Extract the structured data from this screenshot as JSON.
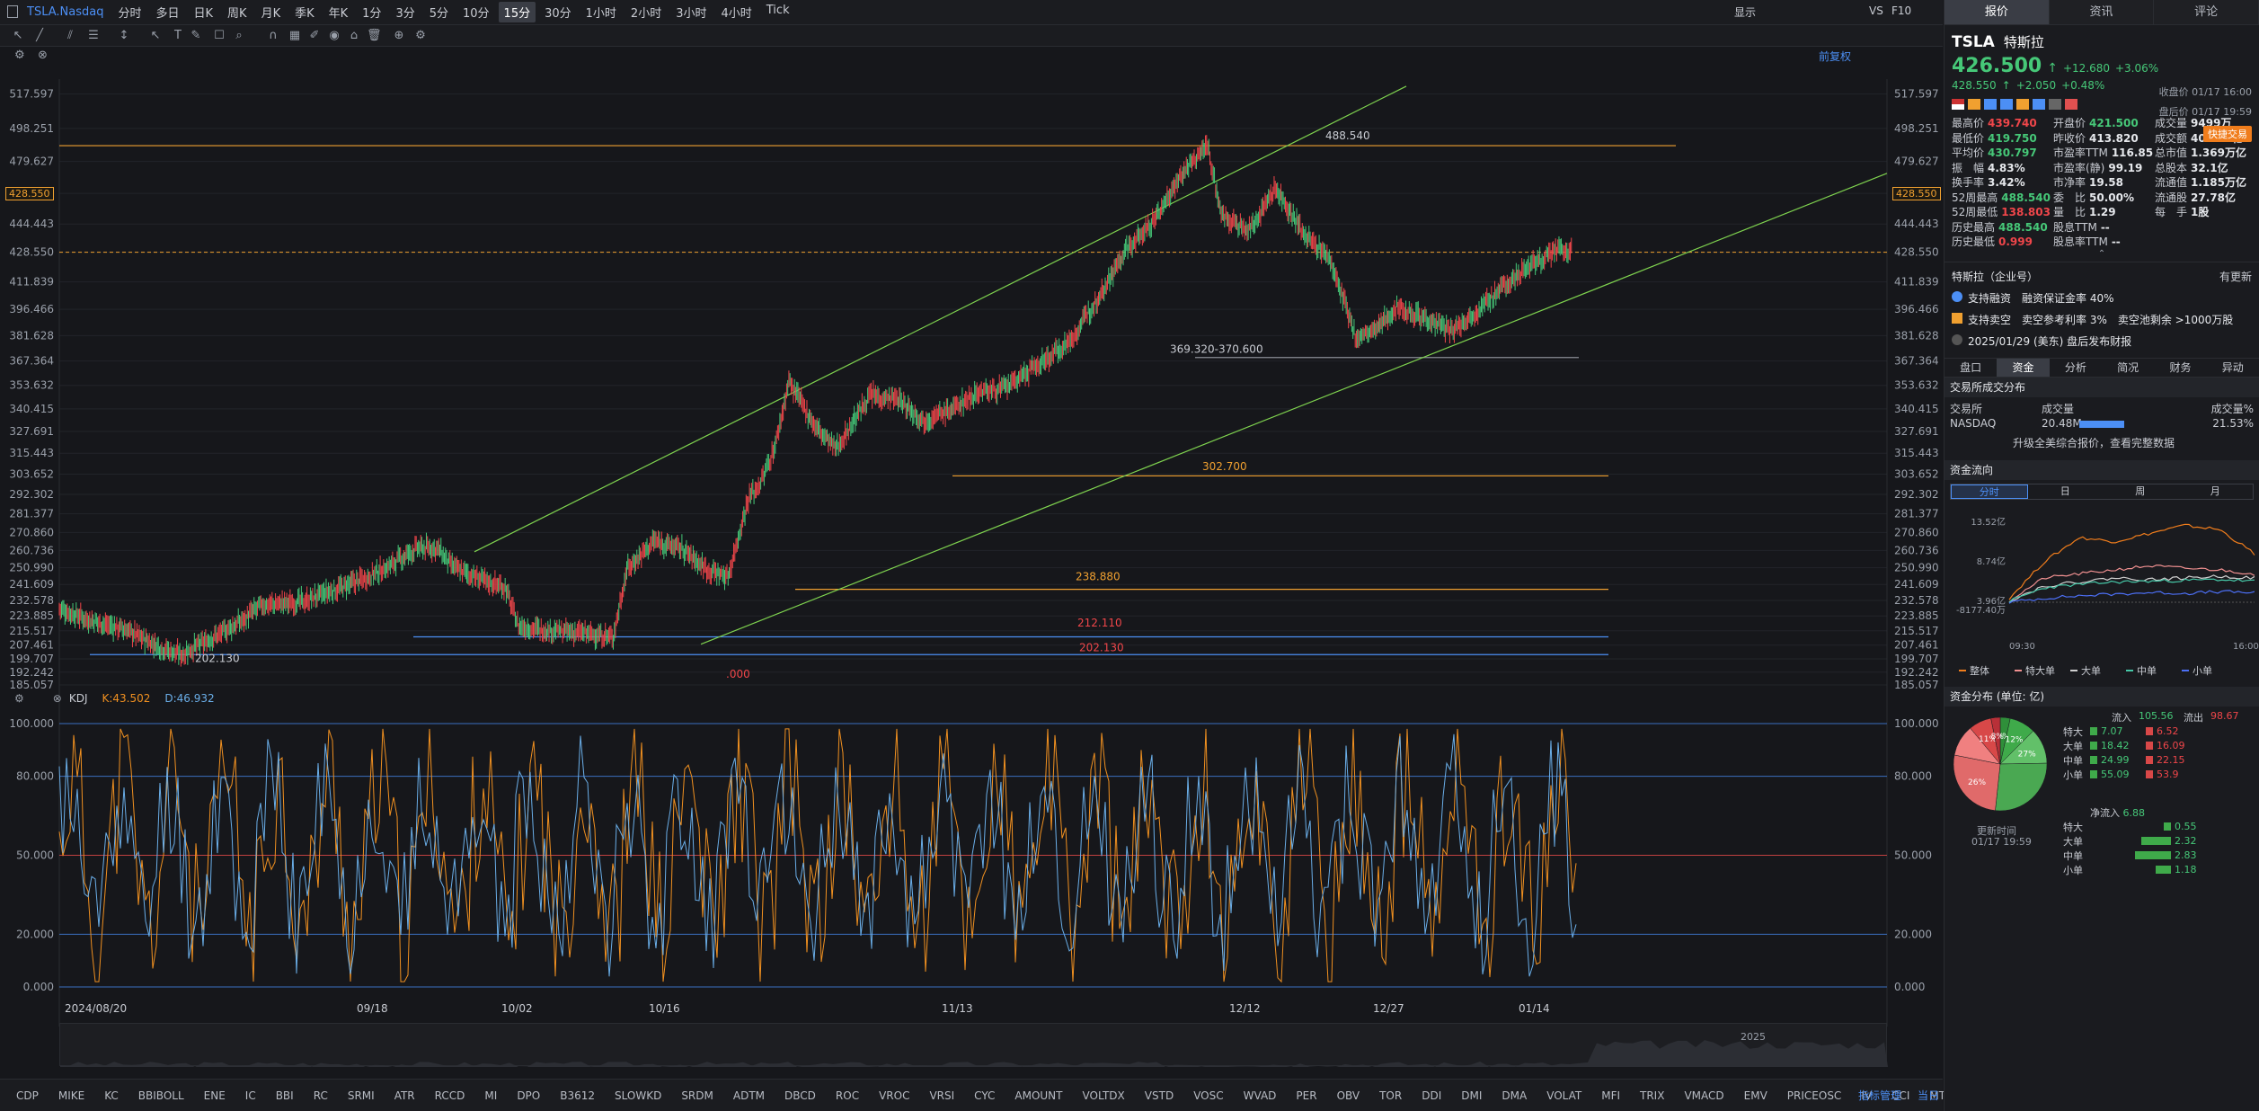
{
  "topbar": {
    "symbol": "TSLA.Nasdaq",
    "periods": [
      "分时",
      "多日",
      "日K",
      "周K",
      "月K",
      "季K",
      "年K",
      "1分",
      "3分",
      "5分",
      "10分",
      "15分",
      "30分",
      "1小时",
      "2小时",
      "3小时",
      "4小时",
      "Tick"
    ],
    "active_period": "15分",
    "right": {
      "display": "显示",
      "vs": "VS",
      "f10": "F10"
    }
  },
  "chart_header": {
    "adjust": "前复权"
  },
  "colors": {
    "up": "#f0464a",
    "down": "#46c878",
    "candle_up": "#f0464a",
    "orange_line": "#f0a030",
    "blue_line": "#4c8ff5",
    "green_channel": "#7fd34f",
    "k_line": "#f09020",
    "d_line": "#6aaee8",
    "bg": "#16171b"
  },
  "chart_data": [
    {
      "type": "line",
      "ylim": [
        185.057,
        526
      ],
      "y_ticks": [
        "517.597",
        "498.251",
        "479.627",
        "461.700",
        "444.443",
        "428.550",
        "411.839",
        "396.466",
        "381.628",
        "367.364",
        "353.632",
        "340.415",
        "327.691",
        "315.443",
        "303.652",
        "292.302",
        "281.377",
        "270.860",
        "260.736",
        "250.990",
        "241.609",
        "232.578",
        "223.885",
        "215.517",
        "207.461",
        "199.707",
        "192.242",
        "185.057"
      ],
      "x_ticks": [
        "2024/08/20",
        "09/18",
        "10/02",
        "10/16",
        "11/13",
        "12/12",
        "12/27",
        "01/14"
      ],
      "current_price_label": "428.550",
      "annotations": [
        "488.540",
        "369.320-370.600",
        "302.700",
        "238.880",
        "212.110",
        "202.130",
        "202.130",
        ".000"
      ],
      "horizontal_levels": [
        {
          "label": "488.540",
          "value": 488.54,
          "color": "orange"
        },
        {
          "label": "369.320-370.600",
          "value": 369.32,
          "color": "grey"
        },
        {
          "label": "302.700",
          "value": 302.7,
          "color": "orange"
        },
        {
          "label": "238.880",
          "value": 238.88,
          "color": "orange"
        },
        {
          "label": "212.110",
          "value": 212.11,
          "color": "blue"
        },
        {
          "label": "202.130",
          "value": 202.13,
          "color": "blue"
        }
      ],
      "price_path": [
        [
          0,
          228
        ],
        [
          5,
          221
        ],
        [
          10,
          216
        ],
        [
          15,
          206
        ],
        [
          18,
          202.13
        ],
        [
          22,
          210
        ],
        [
          27,
          221
        ],
        [
          30,
          230
        ],
        [
          36,
          232
        ],
        [
          42,
          240
        ],
        [
          48,
          250
        ],
        [
          53,
          262
        ],
        [
          56,
          262
        ],
        [
          58,
          252
        ],
        [
          62,
          245
        ],
        [
          66,
          240
        ],
        [
          68,
          218
        ],
        [
          72,
          216
        ],
        [
          78,
          214
        ],
        [
          82,
          212.11
        ],
        [
          84,
          250
        ],
        [
          88,
          266
        ],
        [
          92,
          262
        ],
        [
          96,
          250
        ],
        [
          99,
          246
        ],
        [
          102,
          290
        ],
        [
          104,
          300
        ],
        [
          106,
          320
        ],
        [
          108,
          356
        ],
        [
          112,
          330
        ],
        [
          115,
          318
        ],
        [
          120,
          348
        ],
        [
          124,
          346
        ],
        [
          128,
          334
        ],
        [
          132,
          340
        ],
        [
          136,
          350
        ],
        [
          140,
          352
        ],
        [
          146,
          368
        ],
        [
          150,
          380
        ],
        [
          154,
          405
        ],
        [
          158,
          430
        ],
        [
          162,
          446
        ],
        [
          166,
          472
        ],
        [
          170,
          488.54
        ],
        [
          172,
          450
        ],
        [
          176,
          440
        ],
        [
          180,
          465
        ],
        [
          184,
          440
        ],
        [
          188,
          425
        ],
        [
          192,
          380
        ],
        [
          195,
          385
        ],
        [
          198,
          398
        ],
        [
          202,
          392
        ],
        [
          206,
          384
        ],
        [
          210,
          396
        ],
        [
          214,
          410
        ],
        [
          218,
          422
        ],
        [
          222,
          430
        ],
        [
          224,
          428.55
        ]
      ],
      "x_max": 224
    },
    {
      "type": "line",
      "title": "KDJ",
      "series": [
        {
          "name": "K",
          "value_label": "K:43.502"
        },
        {
          "name": "D",
          "value_label": "D:46.932"
        }
      ],
      "ylim": [
        0,
        100
      ],
      "y_ticks": [
        "100.000",
        "80.000",
        "50.000",
        "20.000",
        "0.000"
      ]
    },
    {
      "type": "line",
      "title": "资金流向",
      "y_ticks": [
        "13.52亿",
        "8.74亿",
        "3.96亿",
        "-8177.40万"
      ],
      "x_ticks": [
        "09:30",
        "16:00"
      ],
      "series": [
        {
          "name": "整体"
        },
        {
          "name": "特大单"
        },
        {
          "name": "大单"
        },
        {
          "name": "中单"
        },
        {
          "name": "小单"
        }
      ]
    },
    {
      "type": "pie",
      "title": "资金分布 (单位: 亿)",
      "slices": [
        {
          "label": "特大流入",
          "value": 7.07,
          "pct": "9%",
          "color": "#2f8f3a"
        },
        {
          "label": "大单流入",
          "value": 18.42,
          "pct": "12%",
          "color": "#3faa4a"
        },
        {
          "label": "中单流入",
          "value": 24.99,
          "pct": "27%",
          "color": "#62c069"
        },
        {
          "label": "小单流入",
          "value": 55.09,
          "pct": "",
          "color": "#4aa852"
        },
        {
          "label": "小单流出",
          "value": 53.9,
          "pct": "26%",
          "color": "#e06a6a"
        },
        {
          "label": "中单流出",
          "value": 22.15,
          "pct": "",
          "color": "#f08080"
        },
        {
          "label": "大单流出",
          "value": 16.09,
          "pct": "11%",
          "color": "#d84848"
        },
        {
          "label": "特大流出",
          "value": 6.52,
          "pct": "8%",
          "color": "#b83038"
        }
      ]
    }
  ],
  "bottom_indicators": [
    "CDP",
    "MIKE",
    "KC",
    "BBIBOLL",
    "ENE",
    "IC",
    "BBI",
    "RC",
    "SRMI",
    "ATR",
    "RCCD",
    "MI",
    "DPO",
    "B3612",
    "SLOWKD",
    "SRDM",
    "ADTM",
    "DBCD",
    "ROC",
    "VROC",
    "VRSI",
    "CYC",
    "AMOUNT",
    "VOLTDX",
    "VSTD",
    "VOSC",
    "WVAD",
    "PER",
    "OBV",
    "TOR",
    "DDI",
    "DMI",
    "DMA",
    "VOLAT",
    "MFI",
    "TRIX",
    "VMACD",
    "EMV",
    "PRICEOSC",
    "IV",
    "CCI",
    "MTM"
  ],
  "bottom_right": {
    "manage": "指标管理",
    "exit": "当日"
  },
  "scroll_label": "2025",
  "quote": {
    "tabs": [
      "报价",
      "资讯",
      "评论"
    ],
    "code": "TSLA",
    "name": "特斯拉",
    "price": "426.500",
    "change": "+12.680",
    "change_pct": "+3.06%",
    "close_label": "收盘价 01/17 16:00",
    "after_price": "428.550",
    "after_change": "+2.050",
    "after_pct": "+0.48%",
    "after_label": "盘后价 01/17 19:59",
    "quick_trade": "快捷交易",
    "stats": [
      [
        "最高价",
        "439.740",
        "开盘价",
        "421.500",
        "成交量",
        "9499万"
      ],
      [
        "最低价",
        "419.750",
        "昨收价",
        "413.820",
        "成交额",
        "409.22亿"
      ],
      [
        "平均价",
        "430.797",
        "市盈率TTM",
        "116.85",
        "总市值",
        "1.369万亿"
      ],
      [
        "振　幅",
        "4.83%",
        "市盈率(静)",
        "99.19",
        "总股本",
        "32.1亿"
      ],
      [
        "换手率",
        "3.42%",
        "市净率",
        "19.58",
        "流通值",
        "1.185万亿"
      ],
      [
        "52周最高",
        "488.540",
        "委　比",
        "50.00%",
        "流通股",
        "27.78亿"
      ],
      [
        "52周最低",
        "138.803",
        "量　比",
        "1.29",
        "每　手",
        "1股"
      ],
      [
        "历史最高",
        "488.540",
        "股息TTM",
        "--",
        "",
        ""
      ],
      [
        "历史最低",
        "0.999",
        "股息率TTM",
        "--",
        "",
        ""
      ]
    ],
    "company": "特斯拉（企业号）",
    "company_update": "有更新",
    "margin": "支持融资　融资保证金率 40%",
    "short": "支持卖空　卖空参考利率 3%　卖空池剩余 >1000万股",
    "earnings": "2025/01/29 (美东) 盘后发布财报",
    "subtabs": [
      "盘口",
      "资金",
      "分析",
      "简况",
      "财务",
      "异动"
    ],
    "exchange_title": "交易所成交分布",
    "exchange_headers": [
      "交易所",
      "成交量",
      "成交量%"
    ],
    "exchange_row": [
      "NASDAQ",
      "20.48M",
      "21.53%"
    ],
    "upgrade": "升级全美综合报价，查看完整数据",
    "flow_title": "资金流向",
    "flow_tabs": [
      "分时",
      "日",
      "周",
      "月"
    ],
    "dist_in": "流入",
    "dist_in_total": "105.56",
    "dist_out": "流出",
    "dist_out_total": "98.67",
    "dist_rows": [
      [
        "特大",
        "7.07",
        "6.52"
      ],
      [
        "大单",
        "18.42",
        "16.09"
      ],
      [
        "中单",
        "24.99",
        "22.15"
      ],
      [
        "小单",
        "55.09",
        "53.9"
      ]
    ],
    "update_label": "更新时间",
    "update_time": "01/17 19:59",
    "net_label": "净流入",
    "net_total": "6.88",
    "net_rows": [
      [
        "特大",
        "0.55"
      ],
      [
        "大单",
        "2.32"
      ],
      [
        "中单",
        "2.83"
      ],
      [
        "小单",
        "1.18"
      ]
    ]
  }
}
